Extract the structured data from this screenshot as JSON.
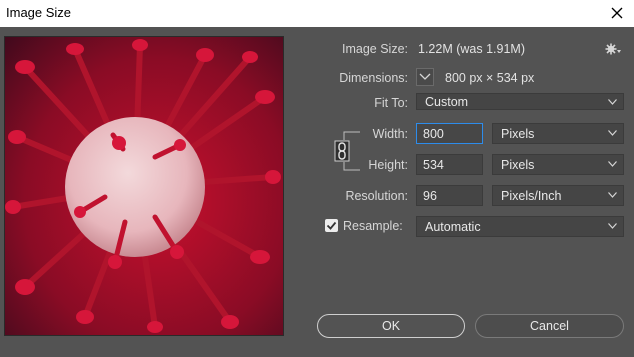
{
  "window": {
    "title": "Image Size"
  },
  "info": {
    "image_size_label": "Image Size:",
    "image_size_value": "1.22M (was 1.91M)",
    "dimensions_label": "Dimensions:",
    "dimensions_value": "800 px  ×  534 px"
  },
  "fit_to": {
    "label": "Fit To:",
    "value": "Custom"
  },
  "width": {
    "label": "Width:",
    "value": "800",
    "unit": "Pixels"
  },
  "height": {
    "label": "Height:",
    "value": "534",
    "unit": "Pixels"
  },
  "resolution": {
    "label": "Resolution:",
    "value": "96",
    "unit": "Pixels/Inch"
  },
  "resample": {
    "label": "Resample:",
    "value": "Automatic",
    "checked": true
  },
  "buttons": {
    "ok": "OK",
    "cancel": "Cancel"
  },
  "icons": {
    "close": "close-icon",
    "gear": "gear-icon",
    "chain": "chain-link-icon",
    "dimensions_toggle": "chevron-down-icon"
  },
  "colors": {
    "dialog_bg": "#535353",
    "accent_focus": "#2d8ceb",
    "titlebar": "#ffffff"
  }
}
